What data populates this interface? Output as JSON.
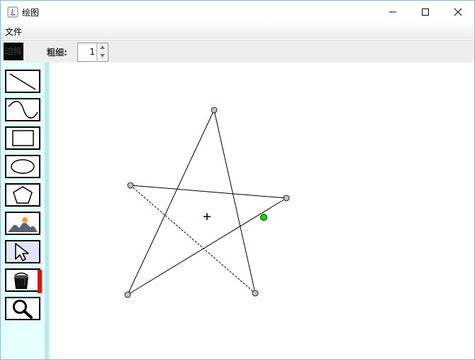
{
  "window": {
    "title": "绘图",
    "buttons": [
      "minimize",
      "maximize",
      "close"
    ]
  },
  "menu": {
    "items": [
      "文件"
    ]
  },
  "toolbar": {
    "border_button_label": "边框",
    "thickness_label": "粗细:",
    "thickness_value": "1"
  },
  "palette": {
    "tools": [
      {
        "name": "line",
        "icon": "line-icon"
      },
      {
        "name": "curve",
        "icon": "curve-icon"
      },
      {
        "name": "rectangle",
        "icon": "rectangle-icon"
      },
      {
        "name": "ellipse",
        "icon": "ellipse-icon"
      },
      {
        "name": "polygon",
        "icon": "pentagon-icon"
      },
      {
        "name": "image",
        "icon": "mountain-image-icon"
      },
      {
        "name": "select",
        "icon": "cursor-arrow-icon",
        "selected": true
      },
      {
        "name": "fill",
        "icon": "paint-bucket-icon",
        "current_color": "#ff0000"
      },
      {
        "name": "zoom",
        "icon": "magnifier-icon"
      }
    ]
  },
  "canvas": {
    "shape": "star-polyline",
    "handle_color": "#c0c0c0",
    "active_handle_color": "#00dd00"
  }
}
